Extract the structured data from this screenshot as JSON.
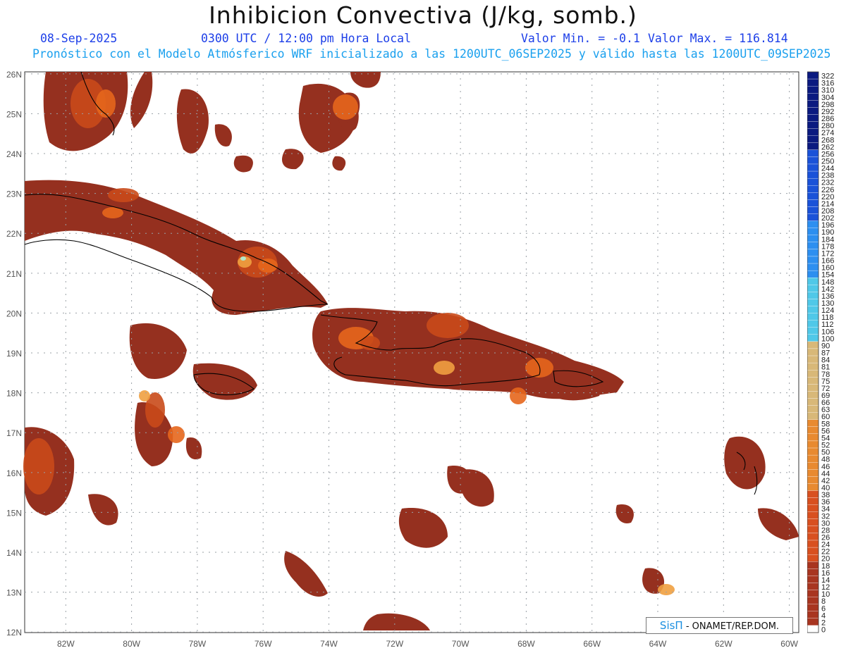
{
  "header": {
    "title": "Inhibicion Convectiva (J/kg, somb.)",
    "date": "08-Sep-2025",
    "time": "0300 UTC / 12:00 pm Hora Local",
    "valmin": "Valor Min. = -0.1",
    "valmax": "Valor Max. = 116.814",
    "subtitle": "Pronóstico con el Modelo Atmósferico WRF inicializado a las 1200UTC_06SEP2025 y válido hasta las  1200UTC_09SEP2025"
  },
  "map": {
    "lat_labels": [
      "26N",
      "25N",
      "24N",
      "23N",
      "22N",
      "21N",
      "20N",
      "19N",
      "18N",
      "17N",
      "16N",
      "15N",
      "14N",
      "13N",
      "12N"
    ],
    "lon_labels": [
      "82W",
      "80W",
      "78W",
      "76W",
      "74W",
      "72W",
      "70W",
      "68W",
      "66W",
      "64W",
      "62W",
      "60W"
    ],
    "fill_color": "#95301f",
    "highlight_colors": [
      "#c94a1a",
      "#e5661c",
      "#f0a040",
      "#aef0d8"
    ]
  },
  "colorbar": {
    "labels": [
      "322",
      "316",
      "310",
      "304",
      "298",
      "292",
      "286",
      "280",
      "274",
      "268",
      "262",
      "256",
      "250",
      "244",
      "238",
      "232",
      "226",
      "220",
      "214",
      "208",
      "202",
      "196",
      "190",
      "184",
      "178",
      "172",
      "166",
      "160",
      "154",
      "148",
      "142",
      "136",
      "130",
      "124",
      "118",
      "112",
      "106",
      "100",
      "90",
      "87",
      "84",
      "81",
      "78",
      "75",
      "72",
      "69",
      "66",
      "63",
      "60",
      "58",
      "56",
      "54",
      "52",
      "50",
      "48",
      "46",
      "44",
      "42",
      "40",
      "38",
      "36",
      "34",
      "32",
      "30",
      "28",
      "26",
      "24",
      "22",
      "20",
      "18",
      "16",
      "14",
      "12",
      "10",
      "8",
      "6",
      "4",
      "2",
      "0"
    ]
  },
  "credit": {
    "brand": "SisΠ",
    "text": " - ONAMET/REP.DOM."
  }
}
